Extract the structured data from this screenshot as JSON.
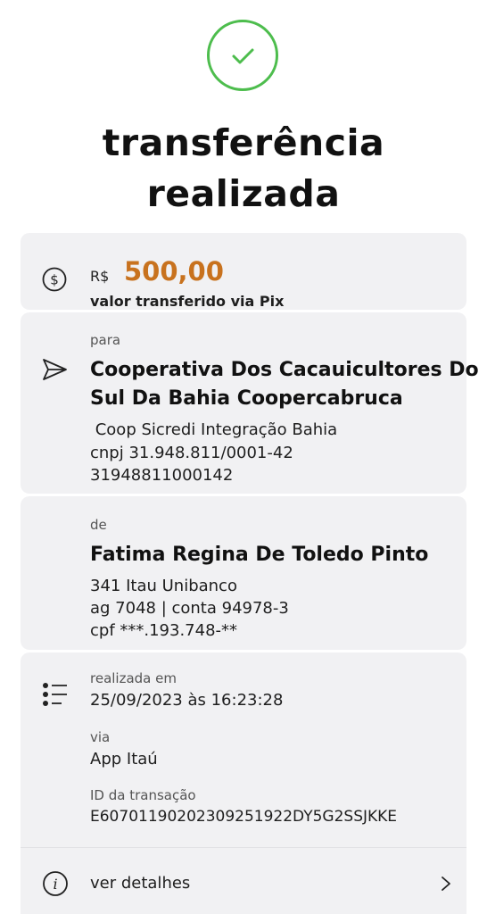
{
  "header": {
    "title_line1": "transferência",
    "title_line2": "realizada",
    "status_icon": "check-circle-icon",
    "status_color": "#4dbd4d"
  },
  "amount": {
    "currency": "R$",
    "value": "500,00",
    "subtitle": "valor transferido via Pix",
    "value_color": "#c8721e"
  },
  "recipient": {
    "label": "para",
    "name_line1": "Cooperativa Dos Cacauicultores Do",
    "name_line2": "Sul Da Bahia Coopercabruca",
    "bank": " Coop Sicredi Integração Bahia",
    "cnpj": "cnpj 31.948.811/0001-42",
    "key": "31948811000142"
  },
  "sender": {
    "label": "de",
    "name": "Fatima Regina De Toledo Pinto",
    "bank": "341 Itau Unibanco",
    "account": "ag 7048 | conta 94978-3",
    "cpf": "cpf ***.193.748-**"
  },
  "info": {
    "date_label": "realizada em",
    "date_value": "25/09/2023 às 16:23:28",
    "via_label": "via",
    "via_value": "App Itaú",
    "id_label": "ID da transação",
    "id_value": "E60701190202309251922DY5G2SSJKKE",
    "details_label": "ver detalhes"
  }
}
